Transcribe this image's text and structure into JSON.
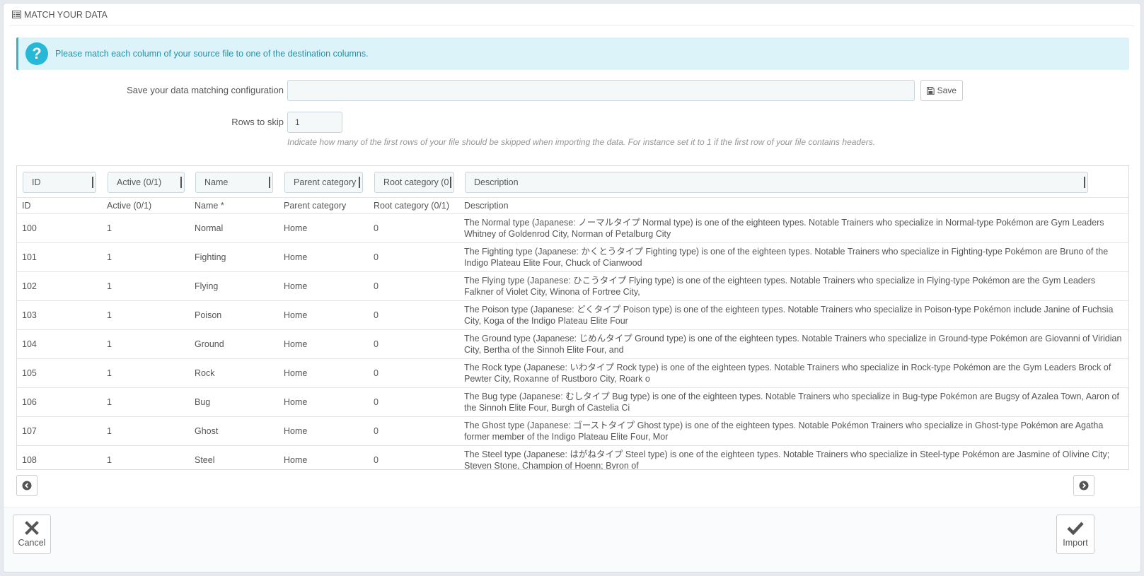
{
  "header": {
    "title": "Match your data",
    "icon": "list-icon"
  },
  "alert": {
    "icon": "question-icon",
    "text": "Please match each column of your source file to one of the destination columns."
  },
  "config": {
    "label": "Save your data matching configuration",
    "value": "",
    "save_label": "Save",
    "save_icon": "floppy-icon"
  },
  "skip": {
    "label": "Rows to skip",
    "value": "1",
    "help": "Indicate how many of the first rows of your file should be skipped when importing the data. For instance set it to 1 if the first row of your file contains headers."
  },
  "selects": [
    "ID",
    "Active (0/1)",
    "Name",
    "Parent category",
    "Root category (0",
    "Description"
  ],
  "columns": [
    "ID",
    "Active (0/1)",
    "Name *",
    "Parent category",
    "Root category (0/1)",
    "Description"
  ],
  "rows": [
    [
      "100",
      "1",
      "Normal",
      "Home",
      "0",
      "The Normal type (Japanese: ノーマルタイプ Normal type) is one of the eighteen types. Notable Trainers who specialize in Normal-type Pokémon are Gym Leaders Whitney of Goldenrod City, Norman of Petalburg City"
    ],
    [
      "101",
      "1",
      "Fighting",
      "Home",
      "0",
      "The Fighting type (Japanese: かくとうタイプ Fighting type) is one of the eighteen types. Notable Trainers who specialize in Fighting-type Pokémon are Bruno of the Indigo Plateau Elite Four, Chuck of Cianwood"
    ],
    [
      "102",
      "1",
      "Flying",
      "Home",
      "0",
      "The Flying type (Japanese: ひこうタイプ Flying type) is one of the eighteen types. Notable Trainers who specialize in Flying-type Pokémon are the Gym Leaders Falkner of Violet City, Winona of Fortree City,"
    ],
    [
      "103",
      "1",
      "Poison",
      "Home",
      "0",
      "The Poison type (Japanese: どくタイプ Poison type) is one of the eighteen types. Notable Trainers who specialize in Poison-type Pokémon include Janine of Fuchsia City, Koga of the Indigo Plateau Elite Four"
    ],
    [
      "104",
      "1",
      "Ground",
      "Home",
      "0",
      "The Ground type (Japanese: じめんタイプ Ground type) is one of the eighteen types. Notable Trainers who specialize in Ground-type Pokémon are Giovanni of Viridian City, Bertha of the Sinnoh Elite Four, and"
    ],
    [
      "105",
      "1",
      "Rock",
      "Home",
      "0",
      "The Rock type (Japanese: いわタイプ Rock type) is one of the eighteen types. Notable Trainers who specialize in Rock-type Pokémon are the Gym Leaders Brock of Pewter City, Roxanne of Rustboro City, Roark o"
    ],
    [
      "106",
      "1",
      "Bug",
      "Home",
      "0",
      "The Bug type (Japanese: むしタイプ Bug type) is one of the eighteen types. Notable Trainers who specialize in Bug-type Pokémon are Bugsy of Azalea Town, Aaron of the Sinnoh Elite Four, Burgh of Castelia Ci"
    ],
    [
      "107",
      "1",
      "Ghost",
      "Home",
      "0",
      "The Ghost type (Japanese: ゴーストタイプ Ghost type) is one of the eighteen types. Notable Pokémon Trainers who specialize in Ghost-type Pokémon are Agatha former member of the Indigo Plateau Elite Four, Mor"
    ],
    [
      "108",
      "1",
      "Steel",
      "Home",
      "0",
      "The Steel type (Japanese: はがねタイプ Steel type) is one of the eighteen types. Notable Trainers who specialize in Steel-type Pokémon are Jasmine of Olivine City; Steven Stone, Champion of Hoenn; Byron of"
    ]
  ],
  "nav": {
    "prev_icon": "chevron-left-circle-icon",
    "next_icon": "chevron-right-circle-icon"
  },
  "footer": {
    "cancel_label": "Cancel",
    "cancel_icon": "close-icon",
    "import_label": "Import",
    "import_icon": "check-icon"
  },
  "colors": {
    "accent": "#25b9d7",
    "alert_bg": "#dcf4f9",
    "alert_text": "#1e94ab"
  }
}
